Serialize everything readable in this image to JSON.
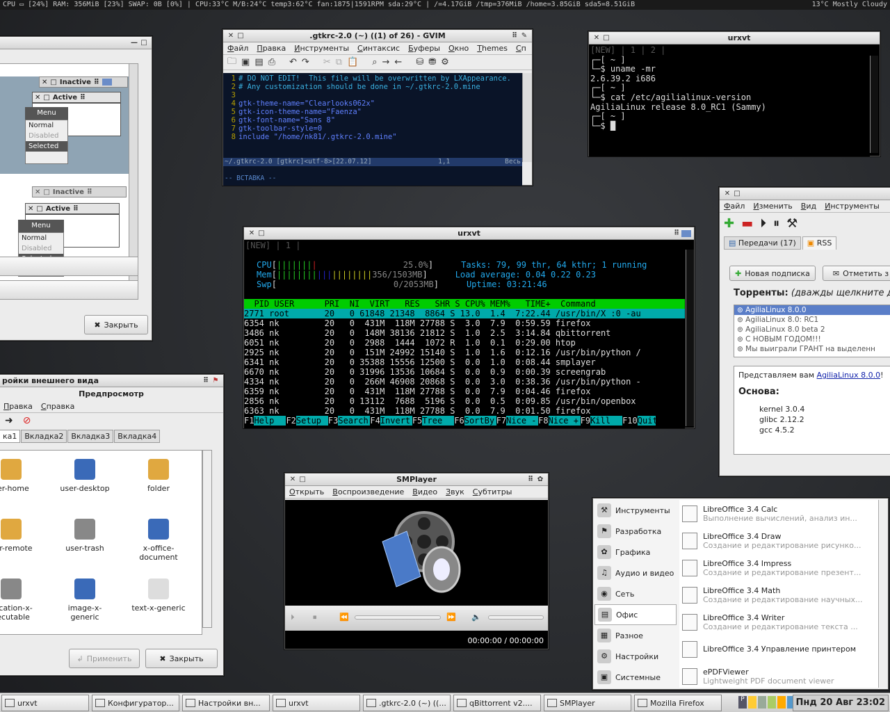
{
  "conky": {
    "left": "CPU ▭ [24%] RAM: 356MiB [23%] SWAP: 0B [0%] | CPU:33°C M/B:24°C temp3:62°C fan:1875|1591RPM sda:29°C | /=4.17GiB /tmp=376MiB /home=3.85GiB sda5=8.51GiB",
    "right": "13°C Mostly Cloudy"
  },
  "lxappear": {
    "inactive": "Inactive",
    "active": "Active",
    "menu": "Menu",
    "normal": "Normal",
    "disabled": "Disabled",
    "selected": "Selected",
    "close": "Закрыть"
  },
  "gvim": {
    "title": ".gtkrc-2.0 (~) ((1) of 26) - GVIM",
    "menu": [
      "Файл",
      "Правка",
      "Инструменты",
      "Синтаксис",
      "Буферы",
      "Окно",
      "Themes",
      "Сп"
    ],
    "lines": [
      {
        "n": "1",
        "t": "# DO NOT EDIT!  This file will be overwritten by LXAppearance."
      },
      {
        "n": "2",
        "t": "# Any customization should be done in ~/.gtkrc-2.0.mine"
      },
      {
        "n": "3",
        "t": ""
      },
      {
        "n": "4",
        "t": "gtk-theme-name=\"Clearlooks062x\""
      },
      {
        "n": "5",
        "t": "gtk-icon-theme-name=\"Faenza\""
      },
      {
        "n": "6",
        "t": "gtk-font-name=\"Sans 8\""
      },
      {
        "n": "7",
        "t": "gtk-toolbar-style=0"
      },
      {
        "n": "8",
        "t": "include \"/home/nk81/.gtkrc-2.0.mine\""
      }
    ],
    "status": "~/.gtkrc-2.0 [gtkrc]<utf-8>[22.07.12]",
    "pos": "1,1",
    "all": "Весь",
    "mode": "-- ВСТАВКА --"
  },
  "urxvt1": {
    "title": "urxvt",
    "lines": [
      "[NEW] | 1 | 2 |",
      "┌─[ ~ ]",
      "└─$ uname -mr",
      "2.6.39.2 i686",
      "┌─[ ~ ]",
      "└─$ cat /etc/agilialinux-version",
      "AgiliaLinux release 8.0_RC1 (Sammy)",
      "┌─[ ~ ]",
      "└─$ █"
    ]
  },
  "htop": {
    "title": "urxvt",
    "tabs": "[NEW] | 1 |",
    "cpu_label": "CPU",
    "cpu_val": "25.0%",
    "mem_label": "Mem",
    "mem_val": "356/1503MB",
    "swp_label": "Swp",
    "swp_val": "0/2053MB",
    "tasks": "Tasks: 79, 99 thr, 64 kthr; 1 running",
    "load": "Load average: 0.04 0.22 0.23",
    "uptime": "Uptime: 03:21:46",
    "header": "  PID USER      PRI  NI  VIRT   RES   SHR S CPU% MEM%   TIME+  Command",
    "rows": [
      "2771 root       20   0 61848 21348  8864 S 13.0  1.4  7:22.44 /usr/bin/X :0 -au",
      "6354 nk         20   0  431M  118M 27788 S  3.0  7.9  0:59.59 firefox",
      "3486 nk         20   0  148M 38136 21812 S  1.0  2.5  3:14.84 qbittorrent",
      "6051 nk         20   0  2988  1444  1072 R  1.0  0.1  0:29.00 htop",
      "2925 nk         20   0  151M 24992 15140 S  1.0  1.6  0:12.16 /usr/bin/python /",
      "6341 nk         20   0 35388 15556 12500 S  0.0  1.0  0:08.44 smplayer",
      "6670 nk         20   0 31996 13536 10684 S  0.0  0.9  0:00.39 screengrab",
      "4334 nk         20   0  266M 46908 20868 S  0.0  3.0  0:38.36 /usr/bin/python -",
      "6359 nk         20   0  431M  118M 27788 S  0.0  7.9  0:04.46 firefox",
      "2856 nk         20   0 13112  7688  5196 S  0.0  0.5  0:09.85 /usr/bin/openbox",
      "6363 nk         20   0  431M  118M 27788 S  0.0  7.9  0:01.50 firefox"
    ],
    "fkeys": [
      [
        "F1",
        "Help"
      ],
      [
        "F2",
        "Setup"
      ],
      [
        "F3",
        "Search"
      ],
      [
        "F4",
        "Invert"
      ],
      [
        "F5",
        "Tree"
      ],
      [
        "F6",
        "SortBy"
      ],
      [
        "F7",
        "Nice -"
      ],
      [
        "F8",
        "Nice +"
      ],
      [
        "F9",
        "Kill"
      ],
      [
        "F10",
        "Quit"
      ]
    ]
  },
  "qbt": {
    "menu": [
      "Файл",
      "Изменить",
      "Вид",
      "Инструменты"
    ],
    "tab_transfers": "Передачи (17)",
    "tab_rss": "RSS",
    "new_sub": "Новая подписка",
    "mark": "Отметить з",
    "torrents_label": "Торренты:",
    "torrents_hint": "(дважды щелкните д",
    "feeds": [
      "AgiliaLinux 8.0.0",
      "AgiliaLinux 8.0: RC1",
      "AgiliaLinux 8.0 beta 2",
      "С НОВЫМ ГОДОМ!!!",
      "Мы выиграли ГРАНТ на выделенн"
    ],
    "intro": "Представляем вам",
    "link": "AgiliaLinux 8.0.0",
    "excl": "!",
    "basis": "Основа:",
    "pkgs": [
      "kernel 3.0.4",
      "glibc 2.12.2",
      "gcc 4.5.2"
    ]
  },
  "lxset": {
    "title": "ройки внешнего вида",
    "preview": "Предпросмотр",
    "menu": [
      "Правка",
      "Справка"
    ],
    "tabs": [
      "ка1",
      "Вкладка2",
      "Вкладка3",
      "Вкладка4"
    ],
    "icons": [
      [
        "ser-home",
        "user-desktop",
        "folder"
      ],
      [
        "der-remote",
        "user-trash",
        "x-office-\ndocument"
      ],
      [
        "plication-x-\nxecutable",
        "image-x-\ngeneric",
        "text-x-generic"
      ]
    ],
    "apply": "Применить",
    "close": "Закрыть"
  },
  "smplayer": {
    "title": "SMPlayer",
    "menu": [
      "Открыть",
      "Воспроизведение",
      "Видео",
      "Звук",
      "Субтитры"
    ],
    "time": "00:00:00 / 00:00:00"
  },
  "appmenu": {
    "cats": [
      "Инструменты",
      "Разработка",
      "Графика",
      "Аудио и видео",
      "Сеть",
      "Офис",
      "Разное",
      "Настройки",
      "Системные"
    ],
    "apps": [
      {
        "name": "LibreOffice 3.4 Calc",
        "desc": "Выполнение вычислений, анализ ин..."
      },
      {
        "name": "LibreOffice 3.4 Draw",
        "desc": "Создание и редактирование рисунко..."
      },
      {
        "name": "LibreOffice 3.4 Impress",
        "desc": "Создание и редактирование презент..."
      },
      {
        "name": "LibreOffice 3.4 Math",
        "desc": "Создание и редактирование научных..."
      },
      {
        "name": "LibreOffice 3.4 Writer",
        "desc": "Создание и редактирование текста ..."
      },
      {
        "name": "LibreOffice 3.4 Управление принтером",
        "desc": ""
      },
      {
        "name": "ePDFViewer",
        "desc": "Lightweight PDF document viewer"
      }
    ]
  },
  "taskbar": {
    "items": [
      "urxvt",
      "Конфигуратор...",
      "Настройки вн...",
      "urxvt",
      ".gtkrc-2.0 (~) ((...",
      "qBittorrent v2....",
      "SMPlayer",
      "Mozilla Firefox"
    ],
    "clock": "Пнд 20 Авг 23:02"
  }
}
